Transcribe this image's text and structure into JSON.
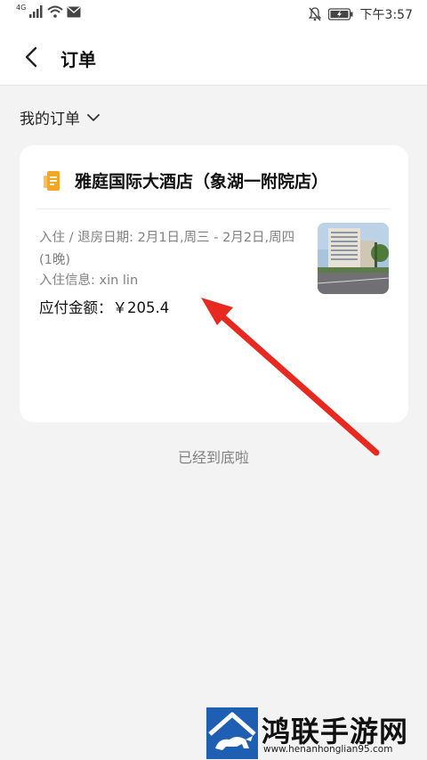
{
  "status_bar": {
    "network": "4G",
    "time": "下午3:57",
    "icons": [
      "signal-icon",
      "wifi-icon",
      "message-icon",
      "mute-bell-icon",
      "battery-icon"
    ]
  },
  "header": {
    "back_icon": "chevron-left-icon",
    "title": "订单"
  },
  "filter": {
    "label": "我的订单",
    "icon": "chevron-down-icon"
  },
  "order": {
    "hotel_icon": "hotel-document-icon",
    "hotel_name": "雅庭国际大酒店（象湖一附院店）",
    "dates": "入住 / 退房日期: 2月1日,周三 - 2月2日,周四(1晚)",
    "guest": "入住信息: xin lin",
    "amount": "应付金额：￥205.4"
  },
  "footer": {
    "end_text": "已经到底啦"
  },
  "watermark": {
    "name": "鸿联手游网",
    "url": "www.henanhonglian95.com"
  },
  "colors": {
    "accent_orange": "#f5a623",
    "annotation_red": "#e8291f",
    "background": "#f3f3f3"
  }
}
